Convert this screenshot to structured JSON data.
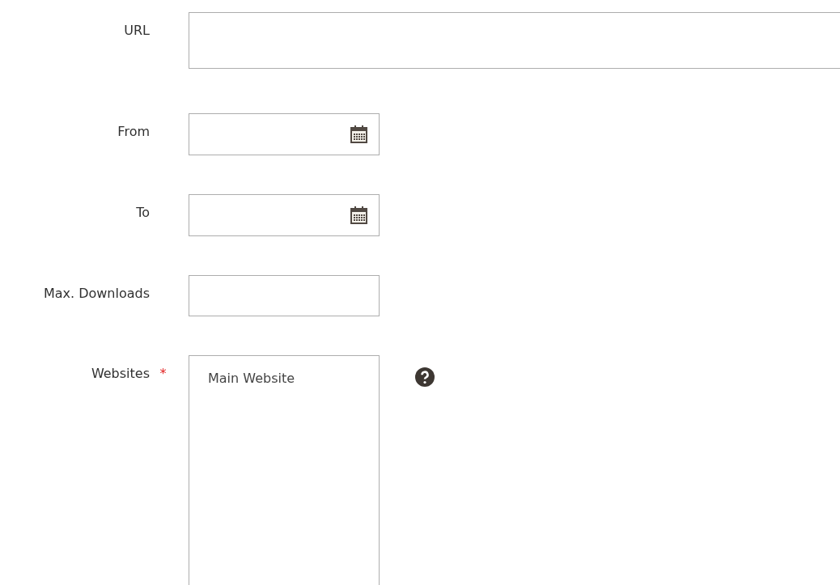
{
  "fields": [
    {
      "label": "URL",
      "kind": "textarea"
    },
    {
      "label": "From",
      "kind": "date"
    },
    {
      "label": "To",
      "kind": "date"
    },
    {
      "label": "Max. Downloads",
      "kind": "text"
    },
    {
      "label": "Websites",
      "kind": "multiselect",
      "required_mark": "*",
      "help": true,
      "options": [
        "Main Website"
      ]
    }
  ]
}
